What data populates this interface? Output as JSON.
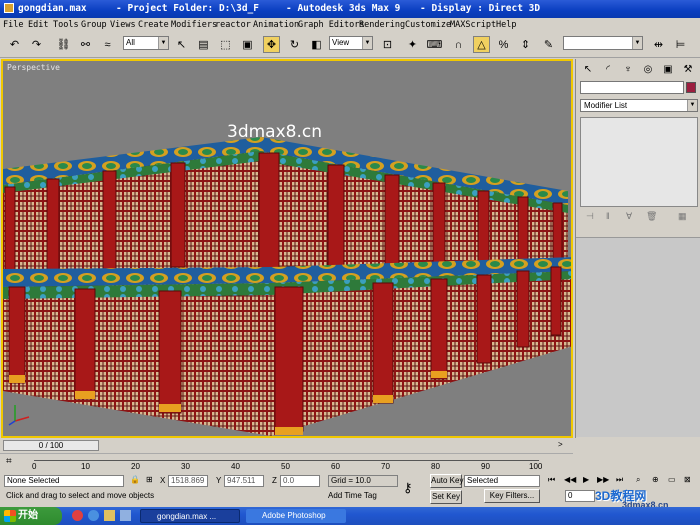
{
  "titlebar": {
    "file": "gongdian.max",
    "project": "- Project Folder: D:\\3d_F",
    "app": "- Autodesk 3ds Max 9",
    "display": "- Display : Direct 3D"
  },
  "menu": [
    "File",
    "Edit",
    "Tools",
    "Group",
    "Views",
    "Create",
    "Modifiers",
    "reactor",
    "Animation",
    "Graph Editors",
    "Rendering",
    "Customize",
    "MAXScript",
    "Help"
  ],
  "toolbar": {
    "selection_filter": "All",
    "ref_coord": "View"
  },
  "viewport": {
    "label": "Perspective",
    "watermark": "3dmax8.cn"
  },
  "command_panel": {
    "modifier_list": "Modifier List",
    "selection_color": "#9c1f3f"
  },
  "timeline": {
    "frame": "0 / 100",
    "ticks": [
      "0",
      "10",
      "20",
      "30",
      "40",
      "50",
      "60",
      "70",
      "80",
      "90",
      "100"
    ]
  },
  "status": {
    "selection": "None Selected",
    "prompt": "Click and drag to select and move objects",
    "x_label": "X",
    "x_value": "1518.869",
    "y_label": "Y",
    "y_value": "947.511",
    "z_label": "Z",
    "z_value": "0.0",
    "grid": "Grid = 10.0",
    "add_time_tag": "Add Time Tag",
    "auto_key": "Auto Key",
    "key_mode": "Selected",
    "set_key": "Set Key",
    "key_filters": "Key Filters...",
    "current_frame": "0"
  },
  "taskbar": {
    "start": "开始",
    "tasks": [
      "gongdian.max ...",
      "Adobe Photoshop"
    ]
  },
  "logo": {
    "text": "3D教程网",
    "sub": "3dmax8.cn"
  }
}
